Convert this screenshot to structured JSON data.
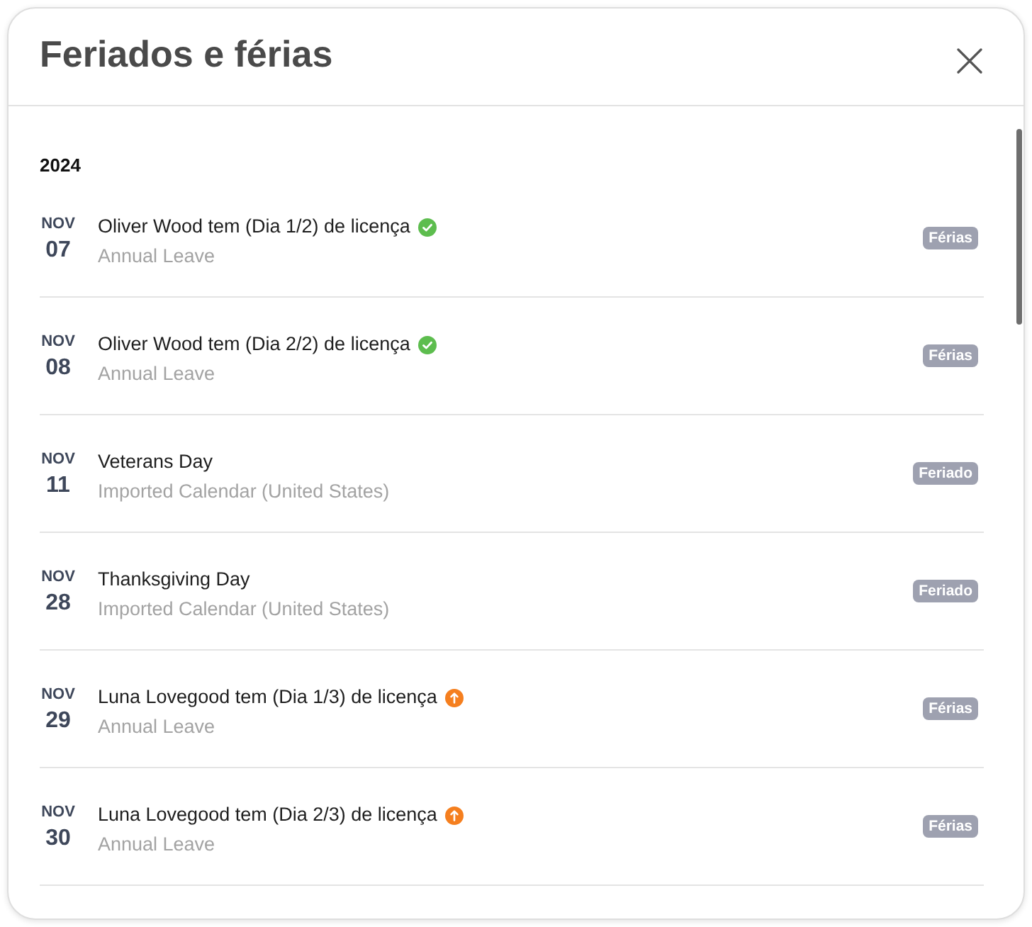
{
  "dialog": {
    "title": "Feriados e férias"
  },
  "groups": [
    {
      "year": "2024",
      "events": [
        {
          "kind": "approved",
          "month": "NOV",
          "day": "07",
          "title": "Oliver Wood tem (Dia 1/2) de licença",
          "subtitle": "Annual Leave",
          "tag": "Férias"
        },
        {
          "kind": "approved",
          "month": "NOV",
          "day": "08",
          "title": "Oliver Wood tem (Dia 2/2) de licença",
          "subtitle": "Annual Leave",
          "tag": "Férias"
        },
        {
          "kind": "holiday",
          "month": "NOV",
          "day": "11",
          "title": "Veterans Day",
          "subtitle": "Imported Calendar (United States)",
          "tag": "Feriado"
        },
        {
          "kind": "holiday",
          "month": "NOV",
          "day": "28",
          "title": "Thanksgiving Day",
          "subtitle": "Imported Calendar (United States)",
          "tag": "Feriado"
        },
        {
          "kind": "pending",
          "month": "NOV",
          "day": "29",
          "title": "Luna Lovegood tem (Dia 1/3) de licença",
          "subtitle": "Annual Leave",
          "tag": "Férias"
        },
        {
          "kind": "pending",
          "month": "NOV",
          "day": "30",
          "title": "Luna Lovegood tem (Dia 2/3) de licença",
          "subtitle": "Annual Leave",
          "tag": "Férias"
        }
      ]
    }
  ]
}
